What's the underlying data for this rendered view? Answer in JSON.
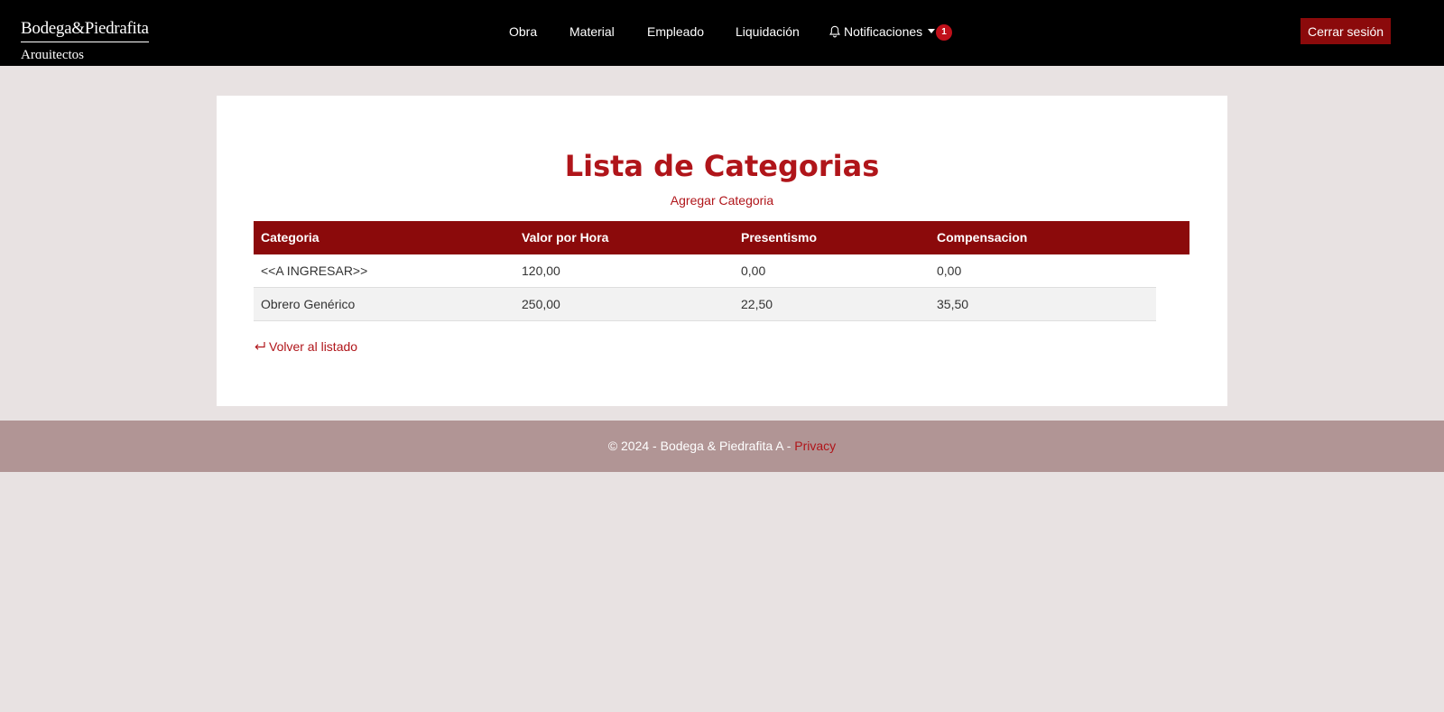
{
  "brand": {
    "line1": "Bodega&Piedrafita",
    "line2": "Arquitectos"
  },
  "nav": {
    "items": [
      {
        "label": "Obra"
      },
      {
        "label": "Material"
      },
      {
        "label": "Empleado"
      },
      {
        "label": "Liquidación"
      }
    ],
    "notifications_label": "Notificaciones",
    "notifications_count": "1",
    "logout_label": "Cerrar sesión"
  },
  "main": {
    "title": "Lista de Categorias",
    "add_link": "Agregar Categoria",
    "back_link": "Volver al listado"
  },
  "table": {
    "headers": [
      "Categoria",
      "Valor por Hora",
      "Presentismo",
      "Compensacion"
    ],
    "rows": [
      [
        "<<A INGRESAR>>",
        "120,00",
        "0,00",
        "0,00"
      ],
      [
        "Obrero Genérico",
        "250,00",
        "22,50",
        "35,50"
      ]
    ]
  },
  "footer": {
    "text": "© 2024 - Bodega & Piedrafita A - ",
    "privacy_link": "Privacy"
  },
  "colors": {
    "navbar_bg": "#000000",
    "accent": "#8b0a0b",
    "title_red": "#b0151a",
    "page_bg": "#e8e2e2",
    "footer_bg": "#b19595"
  }
}
